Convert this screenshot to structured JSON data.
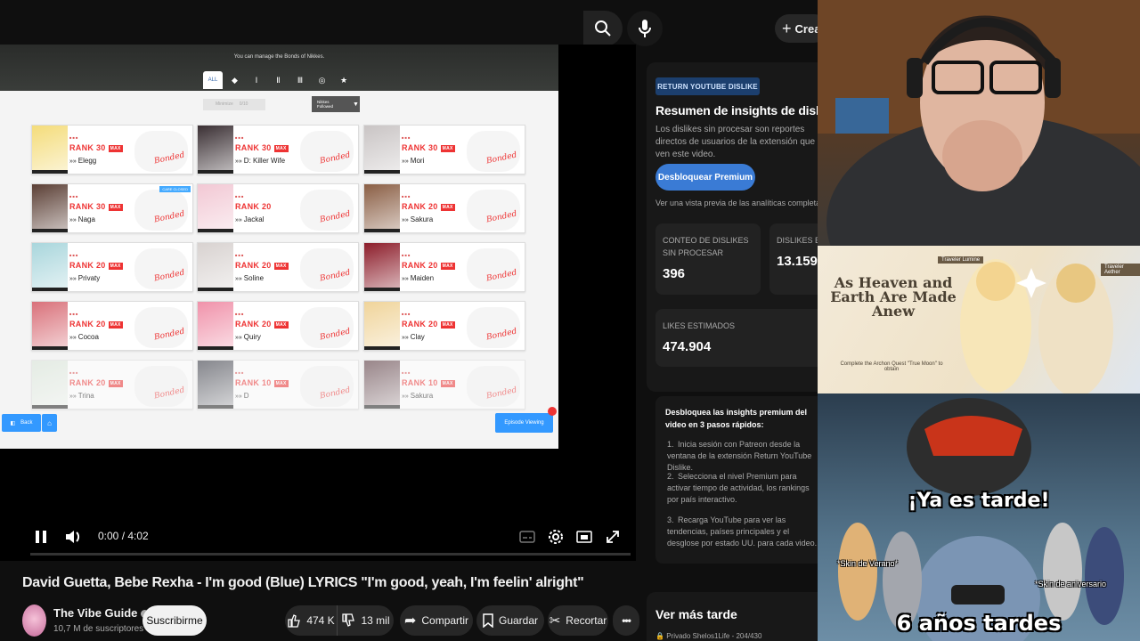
{
  "header": {
    "create_label": "Crear"
  },
  "game": {
    "subtitle": "You can manage the Bonds of Nikkes.",
    "tabs": [
      "ALL",
      "◆",
      "Ⅰ",
      "Ⅱ",
      "Ⅲ",
      "◎",
      "★"
    ],
    "filter_text": "Minimize",
    "filter_count": "0/10",
    "sort_label": "Nikkes Followed",
    "nikkes": [
      {
        "rank": "RANK 30",
        "max": true,
        "name": "Elegg",
        "color": "#f4dc7a"
      },
      {
        "rank": "RANK 30",
        "max": true,
        "name": "D: Killer Wife",
        "color": "#3a2f33"
      },
      {
        "rank": "RANK 30",
        "max": true,
        "name": "Mori",
        "color": "#c9c4c4"
      },
      {
        "rank": "RANK 30",
        "max": true,
        "name": "Naga",
        "color": "#5b3f35",
        "badge": "CARE CLOSED"
      },
      {
        "rank": "RANK 20",
        "max": false,
        "name": "Jackal",
        "color": "#f2c8d4"
      },
      {
        "rank": "RANK 20",
        "max": true,
        "name": "Sakura",
        "color": "#8a5e44"
      },
      {
        "rank": "RANK 20",
        "max": true,
        "name": "Privaty",
        "color": "#a9d6dc"
      },
      {
        "rank": "RANK 20",
        "max": true,
        "name": "Soline",
        "color": "#d8d2d0"
      },
      {
        "rank": "RANK 20",
        "max": true,
        "name": "Maiden",
        "color": "#8c1d2a"
      },
      {
        "rank": "RANK 20",
        "max": true,
        "name": "Cocoa",
        "color": "#d9717a"
      },
      {
        "rank": "RANK 20",
        "max": true,
        "name": "Quiry",
        "color": "#f092aa"
      },
      {
        "rank": "RANK 20",
        "max": true,
        "name": "Clay",
        "color": "#f0d49a"
      },
      {
        "rank": "RANK 20",
        "max": true,
        "name": "Trina",
        "color": "#d9e6d8",
        "faded": true
      },
      {
        "rank": "RANK 10",
        "max": true,
        "name": "D",
        "color": "#2d2f3a",
        "faded": true
      },
      {
        "rank": "RANK 10",
        "max": true,
        "name": "Sakura",
        "color": "#4f2c33",
        "faded": true
      }
    ],
    "back_label": "Back",
    "episode_label": "Episode Viewing"
  },
  "player": {
    "time": "0:00 / 4:02",
    "progress": 0.0
  },
  "video": {
    "title": "David Guetta, Bebe Rexha - I'm good (Blue) LYRICS \"I'm good, yeah, I'm feelin' alright\"",
    "channel": "The Vibe Guide",
    "subscribers": "10,7 M de suscriptores",
    "subscribe_label": "Suscribirme",
    "likes": "474 K",
    "dislikes": "13 mil",
    "share_label": "Compartir",
    "save_label": "Guardar",
    "clip_label": "Recortar"
  },
  "rydl": {
    "badge": "RETURN YOUTUBE DISLIKE",
    "title": "Resumen de insights de dislikes",
    "description": "Los dislikes sin procesar son reportes directos de usuarios de la extensión que ven este video.",
    "unlock_label": "Desbloquear Premium",
    "preview_note": "Ver una vista previa de las analíticas completas",
    "raw_label": "CONTEO DE DISLIKES SIN PROCESAR",
    "raw_value": "396",
    "est_dislikes_label": "DISLIKES E",
    "est_dislikes_value": "13.159",
    "est_likes_label": "LIKES ESTIMADOS",
    "est_likes_value": "474.904",
    "premium_title": "Desbloquea las insights premium del video en 3 pasos rápidos:",
    "steps": [
      "Inicia sesión con Patreon desde la ventana de la extensión Return YouTube Dislike.",
      "Selecciona el nivel Premium para activar tiempo de actividad, los rankings por país interactivo.",
      "Recarga YouTube para ver las tendencias, países principales y el desglose por estado UU. para cada video."
    ]
  },
  "later": {
    "title": "Ver más tarde",
    "sub": "Privado  Shelos1Life - 204/430"
  },
  "overlays": {
    "genshin_title": "As Heaven and Earth Are Made Anew",
    "genshin_left_tag": "Traveler Lumine",
    "genshin_right_tag": "Traveler Aether",
    "genshin_note": "Complete the Archon Quest \"True Moon\" to obtain",
    "meme_top": "¡Ya es tarde!",
    "meme_bottom": "6 años tardes",
    "skin_left": "*Skin de Verano*",
    "skin_right": "*Skin de aniversario"
  }
}
